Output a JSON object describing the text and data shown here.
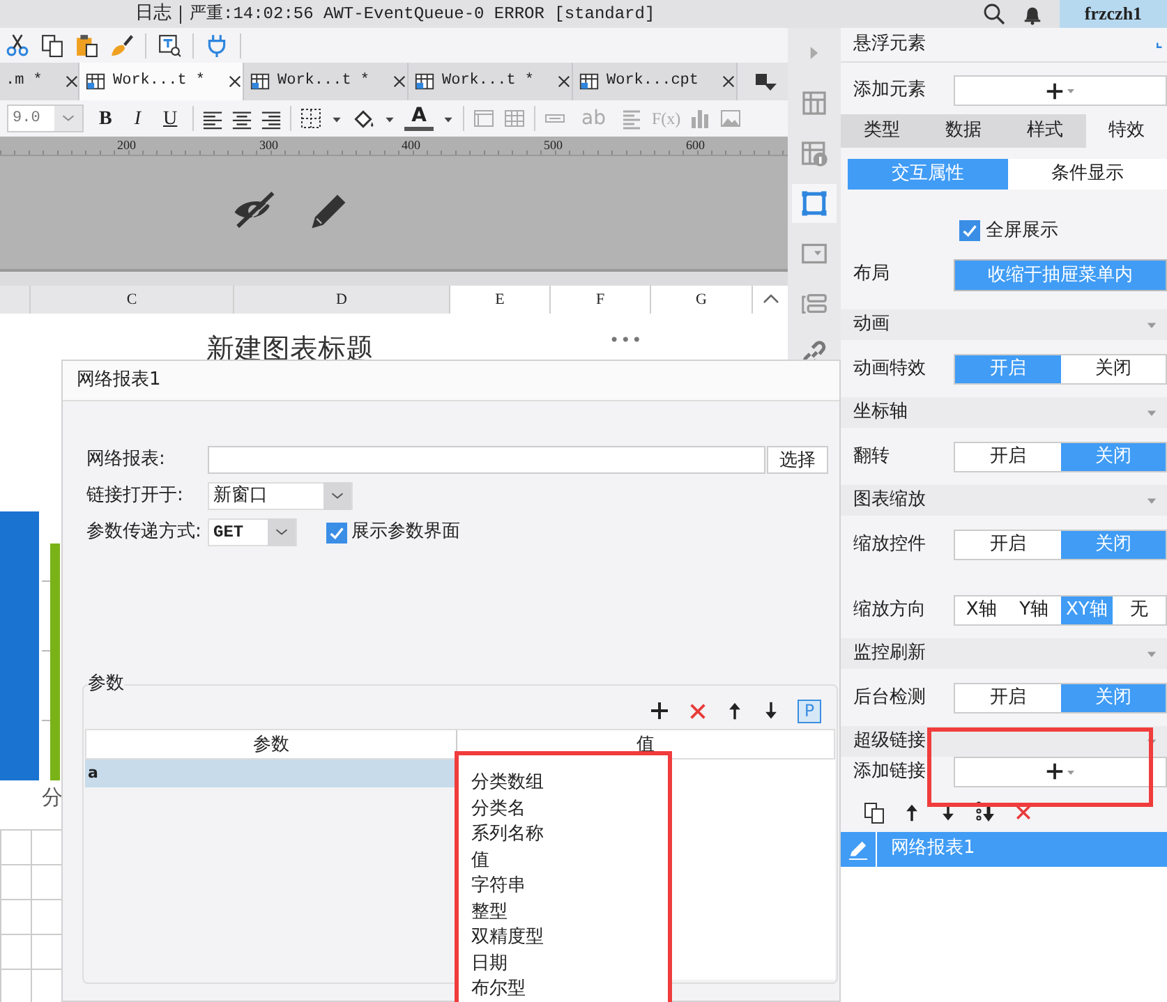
{
  "top_bar": {
    "log_label": "日志",
    "log_message": "严重:14:02:56 AWT-EventQueue-0 ERROR [standard]",
    "user": "frzczh1"
  },
  "file_tabs": [
    {
      "label": ".m *",
      "selected": false
    },
    {
      "label": "Work...t *",
      "selected": true
    },
    {
      "label": "Work...t *",
      "selected": false
    },
    {
      "label": "Work...t *",
      "selected": false
    },
    {
      "label": "Work...cpt",
      "selected": false
    }
  ],
  "format_bar": {
    "font_size": "9.0",
    "style_buttons": [
      "B",
      "I",
      "U"
    ],
    "font_color": "A",
    "text_tool": "ab",
    "formula": "F(x)"
  },
  "ruler": [
    "200",
    "300",
    "400",
    "500",
    "600"
  ],
  "columns": [
    {
      "label": "C",
      "selected": false
    },
    {
      "label": "D",
      "selected": false
    },
    {
      "label": "E",
      "selected": true
    },
    {
      "label": "F",
      "selected": true
    },
    {
      "label": "G",
      "selected": true
    }
  ],
  "chart": {
    "title": "新建图表标题",
    "more": "•••",
    "category_label": "分"
  },
  "side_strip": [
    {
      "kind": "grid",
      "selected": false
    },
    {
      "kind": "info",
      "selected": false
    },
    {
      "kind": "square",
      "selected": true
    },
    {
      "kind": "dropdown",
      "selected": false
    },
    {
      "kind": "widget",
      "selected": false
    },
    {
      "kind": "link",
      "selected": false
    }
  ],
  "dialog": {
    "title": "网络报表1",
    "report": {
      "label": "网络报表:",
      "button": "选择"
    },
    "open_in": {
      "label": "链接打开于:",
      "value": "新窗口"
    },
    "method": {
      "label": "参数传递方式:",
      "value": "GET"
    },
    "show_params": {
      "label": "展示参数界面",
      "checked": true
    },
    "params": {
      "legend": "参数",
      "toolbar_p": "P",
      "columns": [
        "参数",
        "值"
      ],
      "rows": [
        {
          "name": "a",
          "selected": true
        }
      ],
      "value_dropdown": {
        "highlighted": true,
        "options": [
          "分类数组",
          "分类名",
          "系列名称",
          "值",
          "字符串",
          "整型",
          "双精度型",
          "日期",
          "布尔型"
        ]
      }
    }
  },
  "panel": {
    "title": "悬浮元素",
    "add_element": "添加元素",
    "tabs": [
      {
        "label": "类型",
        "selected": false
      },
      {
        "label": "数据",
        "selected": false
      },
      {
        "label": "样式",
        "selected": false
      },
      {
        "label": "特效",
        "selected": true
      }
    ],
    "subtabs": [
      {
        "label": "交互属性",
        "selected": true
      },
      {
        "label": "条件显示",
        "selected": false
      }
    ],
    "fullscreen": {
      "label": "全屏展示",
      "checked": true
    },
    "layout": {
      "label": "布局",
      "value": "收缩于抽屉菜单内"
    },
    "sections": [
      {
        "title": "动画",
        "rows": [
          {
            "label": "动画特效",
            "options": [
              {
                "label": "开启",
                "selected": true
              },
              {
                "label": "关闭",
                "selected": false
              }
            ]
          }
        ]
      },
      {
        "title": "坐标轴",
        "rows": [
          {
            "label": "翻转",
            "options": [
              {
                "label": "开启",
                "selected": false
              },
              {
                "label": "关闭",
                "selected": true
              }
            ]
          }
        ]
      },
      {
        "title": "图表缩放",
        "rows": [
          {
            "label": "缩放控件",
            "options": [
              {
                "label": "开启",
                "selected": false
              },
              {
                "label": "关闭",
                "selected": true
              }
            ]
          },
          {
            "label": "缩放方向",
            "options": [
              {
                "label": "X轴",
                "selected": false
              },
              {
                "label": "Y轴",
                "selected": false
              },
              {
                "label": "XY轴",
                "selected": true
              },
              {
                "label": "无",
                "selected": false
              }
            ]
          }
        ]
      },
      {
        "title": "监控刷新",
        "rows": [
          {
            "label": "后台检测",
            "options": [
              {
                "label": "开启",
                "selected": false
              },
              {
                "label": "关闭",
                "selected": true
              }
            ]
          }
        ]
      },
      {
        "title": "超级链接"
      }
    ],
    "add_link": {
      "label": "添加链接",
      "highlighted": true
    },
    "links": [
      {
        "label": "网络报表1",
        "selected": true
      }
    ]
  }
}
